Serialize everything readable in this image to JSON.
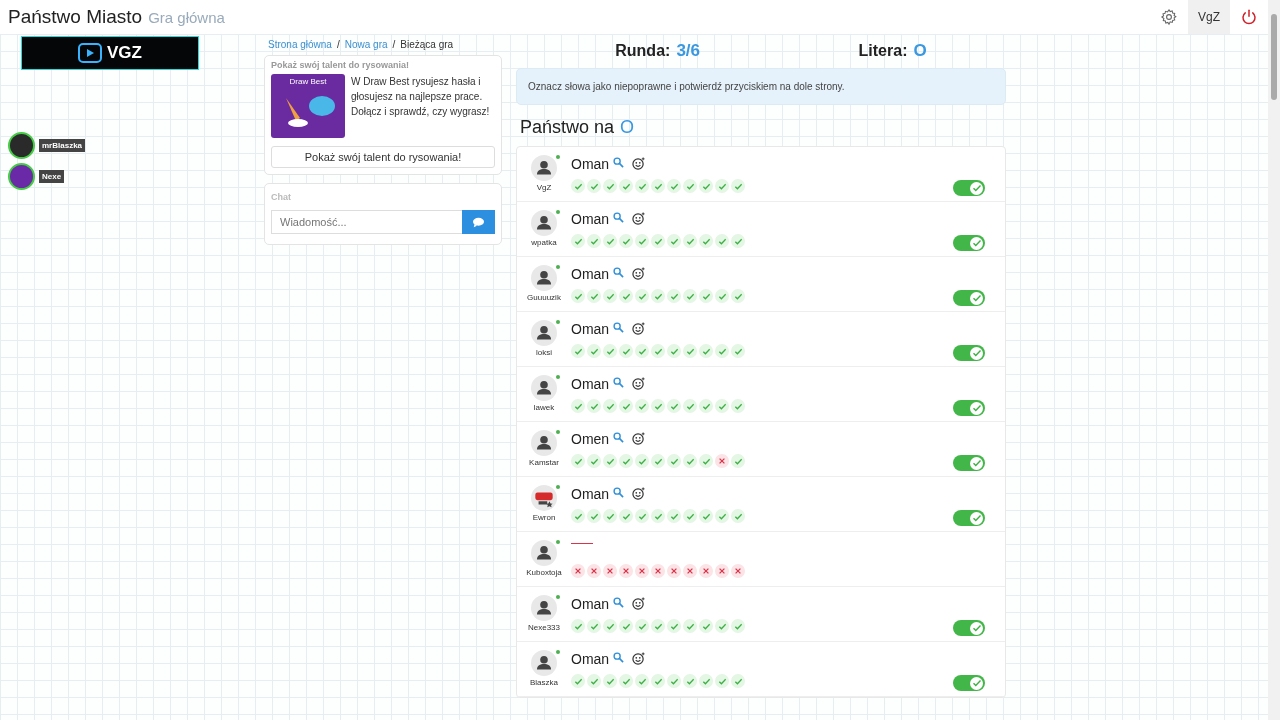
{
  "header": {
    "title": "Państwo Miasto",
    "subtitle": "Gra główna",
    "user": "VgZ"
  },
  "overlay": {
    "logo": "VGZ"
  },
  "viewers": [
    {
      "name": "mrBlaszka",
      "color": "#2a2a2a"
    },
    {
      "name": "Nexe",
      "color": "#6a2aa8"
    }
  ],
  "breadcrumb": {
    "separator": "/",
    "items": [
      {
        "label": "Strona główna",
        "link": true
      },
      {
        "label": "Nowa gra",
        "link": true
      },
      {
        "label": "Bieżąca gra",
        "link": false
      }
    ]
  },
  "promo": {
    "heading": "Pokaż swój talent do rysowania!",
    "image_title": "Draw Best",
    "text": "W Draw Best rysujesz hasła i głosujesz na najlepsze prace. Dołącz i sprawdź, czy wygrasz!",
    "button": "Pokaż swój talent do rysowania!"
  },
  "chat": {
    "heading": "Chat",
    "placeholder": "Wiadomość..."
  },
  "round": {
    "label": "Runda:",
    "value": "3/6"
  },
  "letter": {
    "label": "Litera:",
    "value": "O"
  },
  "notice": "Oznacz słowa jako niepoprawne i potwierdź przyciskiem na dole strony.",
  "category": {
    "label": "Państwo na",
    "letter": "O"
  },
  "answers": [
    {
      "player": "VgZ",
      "avatar": {
        "kind": "person"
      },
      "kind": "answer",
      "word": "Oman",
      "votes": [
        true,
        true,
        true,
        true,
        true,
        true,
        true,
        true,
        true,
        true,
        true
      ],
      "accepted": true
    },
    {
      "player": "wpatka",
      "avatar": {
        "kind": "person"
      },
      "kind": "answer",
      "word": "Oman",
      "votes": [
        true,
        true,
        true,
        true,
        true,
        true,
        true,
        true,
        true,
        true,
        true
      ],
      "accepted": true
    },
    {
      "player": "Guuuuzik",
      "avatar": {
        "kind": "person"
      },
      "kind": "answer",
      "word": "Oman",
      "votes": [
        true,
        true,
        true,
        true,
        true,
        true,
        true,
        true,
        true,
        true,
        true
      ],
      "accepted": true
    },
    {
      "player": "loksi",
      "avatar": {
        "kind": "person"
      },
      "kind": "answer",
      "word": "Oman",
      "votes": [
        true,
        true,
        true,
        true,
        true,
        true,
        true,
        true,
        true,
        true,
        true
      ],
      "accepted": true
    },
    {
      "player": "lawek",
      "avatar": {
        "kind": "person"
      },
      "kind": "answer",
      "word": "Oman",
      "votes": [
        true,
        true,
        true,
        true,
        true,
        true,
        true,
        true,
        true,
        true,
        true
      ],
      "accepted": true
    },
    {
      "player": "Kamstar",
      "avatar": {
        "kind": "person"
      },
      "kind": "answer",
      "word": "Omen",
      "votes": [
        true,
        true,
        true,
        true,
        true,
        true,
        true,
        true,
        true,
        false,
        true
      ],
      "accepted": true
    },
    {
      "player": "Ewron",
      "avatar": {
        "kind": "badge"
      },
      "kind": "answer",
      "word": "Oman",
      "votes": [
        true,
        true,
        true,
        true,
        true,
        true,
        true,
        true,
        true,
        true,
        true
      ],
      "accepted": true
    },
    {
      "player": "Kuboxtoja",
      "avatar": {
        "kind": "person"
      },
      "kind": "blank",
      "votes": [
        false,
        false,
        false,
        false,
        false,
        false,
        false,
        false,
        false,
        false,
        false
      ]
    },
    {
      "player": "Nexe333",
      "avatar": {
        "kind": "person"
      },
      "kind": "answer",
      "word": "Oman",
      "votes": [
        true,
        true,
        true,
        true,
        true,
        true,
        true,
        true,
        true,
        true,
        true
      ],
      "accepted": true
    },
    {
      "player": "Blaszka",
      "avatar": {
        "kind": "person"
      },
      "kind": "answer",
      "word": "Oman",
      "votes": [
        true,
        true,
        true,
        true,
        true,
        true,
        true,
        true,
        true,
        true,
        true
      ],
      "accepted": true
    }
  ]
}
